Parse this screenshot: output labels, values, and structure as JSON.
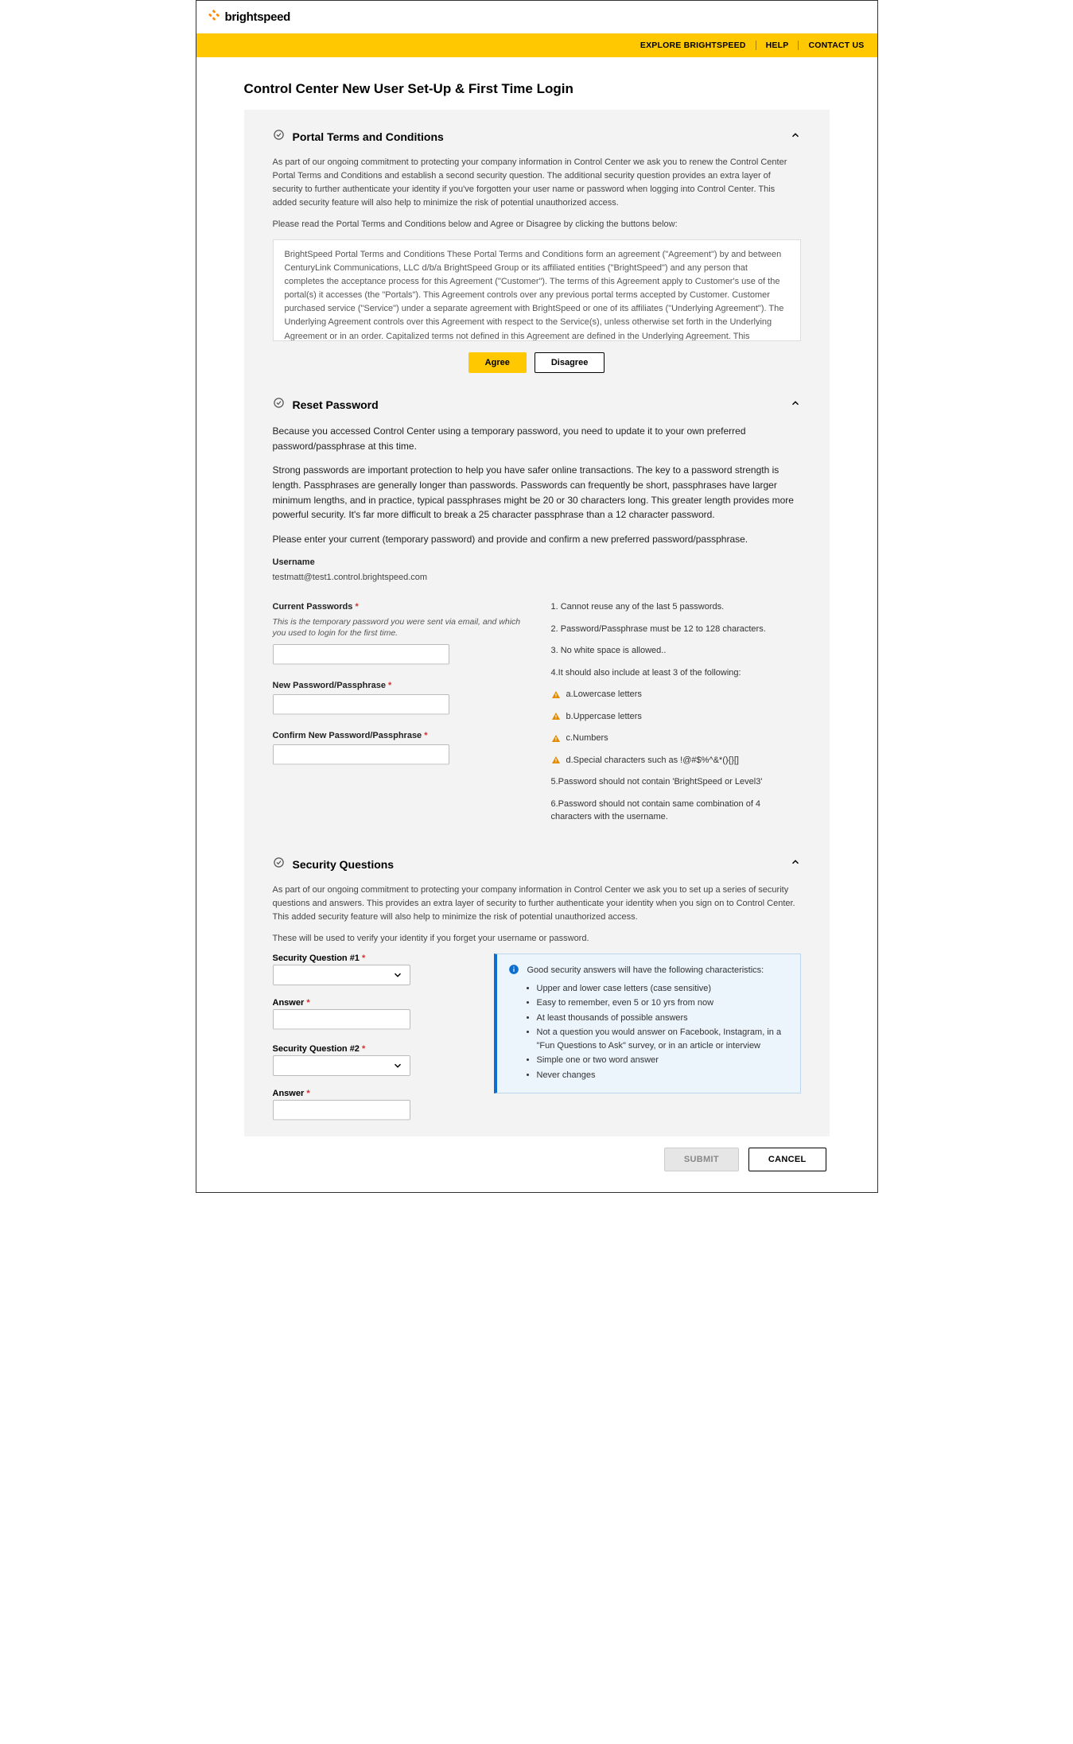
{
  "brand": {
    "name": "brightspeed"
  },
  "nav": {
    "explore": "EXPLORE BRIGHTSPEED",
    "help": "HELP",
    "contact": "CONTACT US"
  },
  "page": {
    "title": "Control Center New User Set-Up & First Time Login"
  },
  "terms": {
    "title": "Portal Terms and Conditions",
    "intro": "As part of our ongoing commitment to protecting your company information in Control Center we ask you to renew the Control Center Portal Terms and Conditions and establish a second security question. The additional security question provides an extra layer of security to further authenticate your identity if you've forgotten your user name or password when logging into Control Center. This added security feature will also help to minimize the risk of potential unauthorized access.",
    "instruction": "Please read the Portal Terms and Conditions below and Agree or Disagree by clicking the buttons below:",
    "body": "BrightSpeed Portal Terms and Conditions These Portal Terms and Conditions form an agreement (\"Agreement\") by and between CenturyLink Communications, LLC d/b/a BrightSpeed Group or its affiliated entities (\"BrightSpeed\") and any person that completes the acceptance process for this Agreement (\"Customer\"). The terms of this Agreement apply to Customer's use of the portal(s) it accesses (the \"Portals\"). This Agreement controls over any previous portal terms accepted by Customer. Customer purchased service (\"Service\") under a separate agreement with BrightSpeed or one of its affiliates (\"Underlying Agreement\"). The Underlying Agreement controls over this Agreement with respect to the Service(s), unless otherwise set forth in the Underlying Agreement or in an order. Capitalized terms not defined in this Agreement are defined in the Underlying Agreement. This Agreement is effective on the date it is accepted by Customer and governs Customer's use of the Portals and associated user guides and documentation (collectively, \"Portal Service\"). By accepting this Agreement or accessing or using any part of the Portal Service, Customer agrees to",
    "agree": "Agree",
    "disagree": "Disagree"
  },
  "reset": {
    "title": "Reset Password",
    "p1": "Because you accessed Control Center using a temporary password, you need to update it to your own preferred password/passphrase at this time.",
    "p2": "Strong passwords are important protection to help you have safer online transactions. The key to a password strength is length. Passphrases are generally longer than passwords. Passwords can frequently be short, passphrases have larger minimum lengths, and in practice, typical passphrases might be 20 or 30 characters long. This greater length provides more powerful security. It's far more difficult to break a 25 character passphrase than a 12 character password.",
    "p3": "Please enter your current (temporary password) and provide and confirm a new preferred password/passphrase.",
    "username_label": "Username",
    "username_value": "testmatt@test1.control.brightspeed.com",
    "current_label": "Current Passwords",
    "current_note": "This is the temporary password you were sent via email, and which you used to login for the first time.",
    "new_label": "New Password/Passphrase",
    "confirm_label": "Confirm New Password/Passphrase",
    "rules": {
      "r1": "1. Cannot reuse any of the last 5 passwords.",
      "r2": "2. Password/Passphrase must be 12 to 128 characters.",
      "r3": "3. No white space is allowed..",
      "r4": "4.It should also include at least 3 of the following:",
      "r4a": "a.Lowercase letters",
      "r4b": "b.Uppercase letters",
      "r4c": "c.Numbers",
      "r4d": "d.Special characters such as !@#$%^&*(){}[]",
      "r5": "5.Password should not contain 'BrightSpeed or Level3'",
      "r6": "6.Password should not contain same combination of 4 characters with the username."
    }
  },
  "security": {
    "title": "Security Questions",
    "intro": "As part of our ongoing commitment to protecting your company information in Control Center we ask you to set up a series of security questions and answers. This provides an extra layer of security to further authenticate your identity when you sign on to Control Center. This added security feature will also help to minimize the risk of potential unauthorized access.",
    "note": "These will be used to verify your identity if you forget your username or password.",
    "q1_label": "Security Question #1",
    "a1_label": "Answer",
    "q2_label": "Security Question #2",
    "a2_label": "Answer",
    "info_title": "Good security answers will have the following characteristics:",
    "tips": {
      "t1": "Upper and lower case letters (case sensitive)",
      "t2": "Easy to remember, even 5 or 10 yrs from now",
      "t3": "At least thousands of possible answers",
      "t4": "Not a question you would answer on Facebook, Instagram, in a \"Fun Questions to Ask\" survey, or in an article or interview",
      "t5": "Simple one or two word answer",
      "t6": "Never changes"
    }
  },
  "footer": {
    "submit": "SUBMIT",
    "cancel": "CANCEL"
  }
}
